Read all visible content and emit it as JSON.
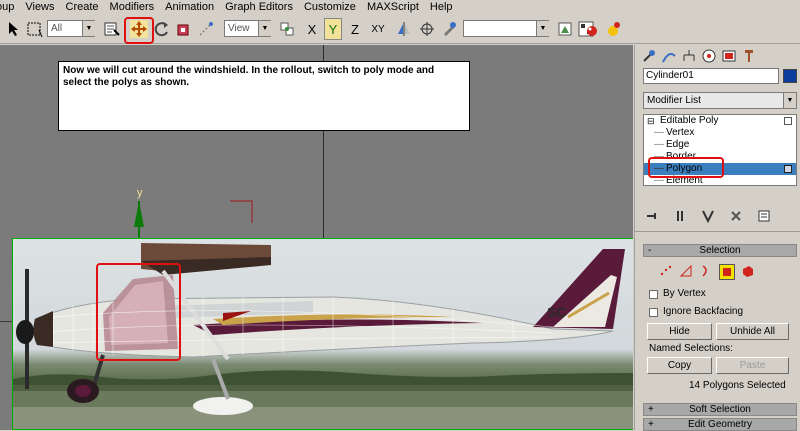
{
  "menu": [
    "oup",
    "Views",
    "Create",
    "Modifiers",
    "Animation",
    "Graph Editors",
    "Customize",
    "MAXScript",
    "Help"
  ],
  "toolbar": {
    "selection_filter": "All",
    "reference_coord": "View",
    "axis_x": "X",
    "axis_y": "Y",
    "axis_z": "Z",
    "axis_xy": "XY",
    "named_selection": ""
  },
  "viewport": {
    "instruction": "Now we will cut around the windshield.  In the rollout, switch to poly mode and select the polys as shown.",
    "axis_label_y": "y"
  },
  "panel": {
    "object_name": "Cylinder01",
    "modifier_list": "Modifier List",
    "stack": {
      "root": "Editable Poly",
      "items": [
        "Vertex",
        "Edge",
        "Border",
        "Polygon",
        "Element"
      ],
      "selected_index": 3
    },
    "selection_rollout": {
      "title": "Selection",
      "minus": "-",
      "by_vertex": "By Vertex",
      "ignore_backfacing": "Ignore Backfacing",
      "hide": "Hide",
      "unhide_all": "Unhide All",
      "named_selections": "Named Selections:",
      "copy": "Copy",
      "paste": "Paste",
      "status": "14 Polygons Selected"
    },
    "soft_selection": {
      "title": "Soft Selection",
      "plus": "+"
    },
    "edit_geometry": {
      "title": "Edit Geometry",
      "plus": "+"
    }
  },
  "colors": {
    "highlight": "#e01010",
    "object_color": "#0b3e9c",
    "stack_selected": "#3b7fbf",
    "aircraft_trim": "#5a1a3a"
  }
}
